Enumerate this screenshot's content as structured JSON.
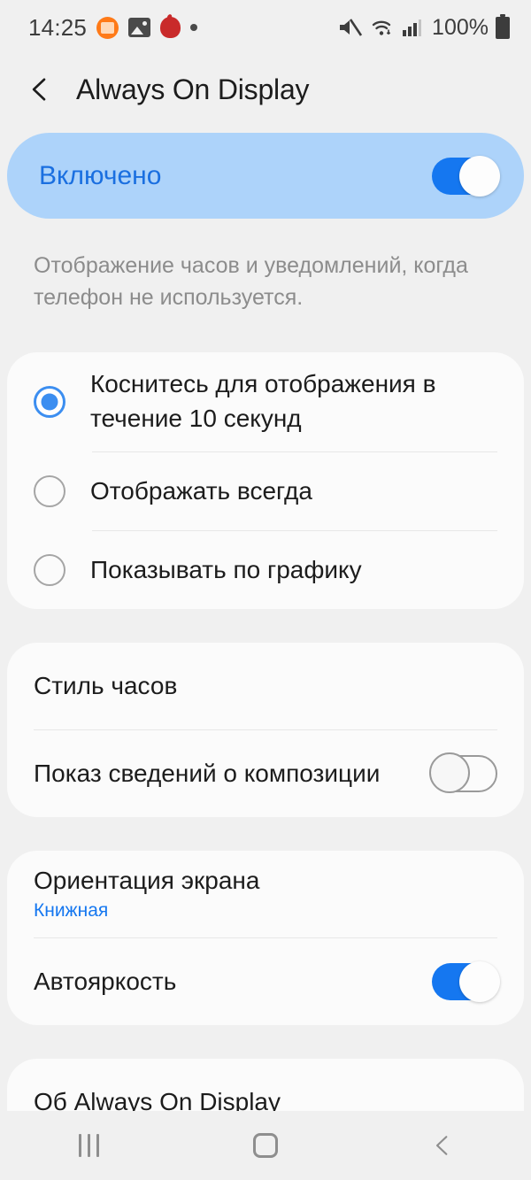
{
  "statusbar": {
    "time": "14:25",
    "battery_percent": "100%",
    "left_icons": [
      "orange-app-icon",
      "gallery-icon",
      "red-app-icon",
      "dot-icon"
    ],
    "right_icons": [
      "mute-icon",
      "wifi-icon",
      "signal-bars-icon",
      "battery-icon"
    ]
  },
  "header": {
    "back_icon": "back-chevron-icon",
    "title": "Always On Display"
  },
  "master_switch": {
    "label": "Включено",
    "state": "on"
  },
  "description": "Отображение часов и уведомлений, когда телефон не используется.",
  "mode_options": [
    {
      "label": "Коснитесь для отображения в течение 10 секунд",
      "selected": true
    },
    {
      "label": "Отображать всегда",
      "selected": false
    },
    {
      "label": "Показывать по графику",
      "selected": false
    }
  ],
  "settings_group": [
    {
      "title": "Стиль часов",
      "control": "none"
    },
    {
      "title": "Показ сведений о композиции",
      "control": "switch",
      "state": "off"
    }
  ],
  "display_group": [
    {
      "title": "Ориентация экрана",
      "subtitle": "Книжная",
      "control": "none"
    },
    {
      "title": "Автояркость",
      "control": "switch",
      "state": "on"
    }
  ],
  "about_group": [
    {
      "title": "Об Always On Display"
    }
  ],
  "navbar": {
    "recents": "recents-icon",
    "home": "home-icon",
    "back": "back-icon"
  },
  "colors": {
    "accent_blue": "#1577F0",
    "master_card_bg": "#ADD3FA",
    "page_bg": "#f0f0f0",
    "card_bg": "#fbfbfb"
  }
}
